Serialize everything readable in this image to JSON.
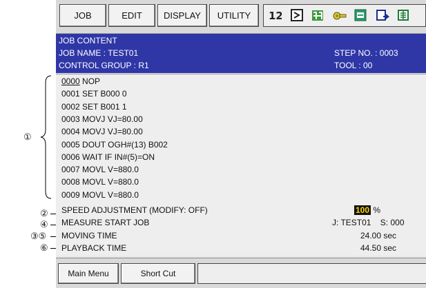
{
  "menu": {
    "job": "JOB",
    "edit": "EDIT",
    "display": "DISPLAY",
    "utility": "UTILITY"
  },
  "status_icons": [
    "coordinate-icon",
    "step-mode-icon",
    "manual-speed-icon",
    "security-key-icon",
    "mode-icon",
    "playback-icon",
    "power-icon"
  ],
  "header": {
    "title": "JOB CONTENT",
    "job_name": "JOB NAME : TEST01",
    "control_group": "CONTROL GROUP : R1",
    "step_no": "STEP NO. : 0003",
    "tool": "TOOL : 00"
  },
  "job_lines": [
    {
      "num": "0000",
      "text": " NOP"
    },
    {
      "num": "0001",
      "text": " SET B000 0"
    },
    {
      "num": "0002",
      "text": " SET B001 1"
    },
    {
      "num": "0003",
      "text": " MOVJ VJ=80.00"
    },
    {
      "num": "0004",
      "text": " MOVJ VJ=80.00"
    },
    {
      "num": "0005",
      "text": " DOUT OGH#(13) B002"
    },
    {
      "num": "0006",
      "text": " WAIT IF IN#(5)=ON"
    },
    {
      "num": "0007",
      "text": " MOVL V=880.0"
    },
    {
      "num": "0008",
      "text": " MOVL V=880.0"
    },
    {
      "num": "0009",
      "text": " MOVL V=880.0"
    }
  ],
  "info": {
    "speed_label": "SPEED ADJUSTMENT (MODIFY: OFF)",
    "speed_value": "100",
    "speed_unit": "%",
    "measure_label": "MEASURE START JOB",
    "measure_value": "J: TEST01    S: 000",
    "moving_label": "MOVING TIME",
    "moving_value": "24.00 sec",
    "playback_label": "PLAYBACK TIME",
    "playback_value": "44.50 sec"
  },
  "bottom": {
    "main_menu": "Main Menu",
    "short_cut": "Short Cut"
  },
  "callouts": {
    "c1": "①",
    "c2": "②",
    "c4": "④",
    "c35": "③⑤",
    "c6": "⑥"
  },
  "colors": {
    "header_bg": "#2f37a7",
    "speed_bg": "#111111",
    "speed_fg": "#ffd400"
  }
}
